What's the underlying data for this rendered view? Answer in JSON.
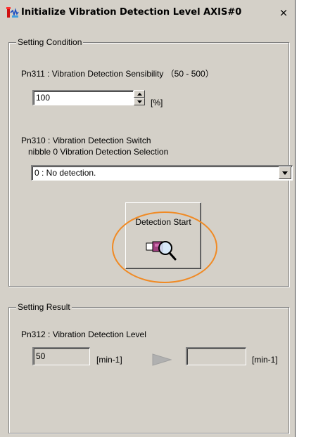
{
  "window": {
    "title": "Initialize Vibration Detection Level AXIS#0",
    "close_glyph": "×",
    "icon": "vibration-app-icon"
  },
  "setting_condition": {
    "legend": "Setting Condition",
    "sensibility": {
      "label": "Pn311 : Vibration Detection Sensibility （50 - 500）",
      "value": "100",
      "unit": "[%]"
    },
    "switch": {
      "label_line1": "Pn310 : Vibration Detection Switch",
      "label_line2": "nibble 0 Vibration Detection Selection",
      "selected": "0 : No detection."
    },
    "detection_start": {
      "label": "Detection Start",
      "icon": "detection-search-icon"
    }
  },
  "setting_result": {
    "legend": "Setting Result",
    "level": {
      "label": "Pn312 : Vibration Detection Level",
      "current_value": "50",
      "current_unit": "[min-1]",
      "new_value": "",
      "new_unit": "[min-1]",
      "arrow_icon": "right-arrow-icon"
    }
  },
  "colors": {
    "face": "#d4d0c8",
    "highlight_ring": "#f08a24"
  }
}
